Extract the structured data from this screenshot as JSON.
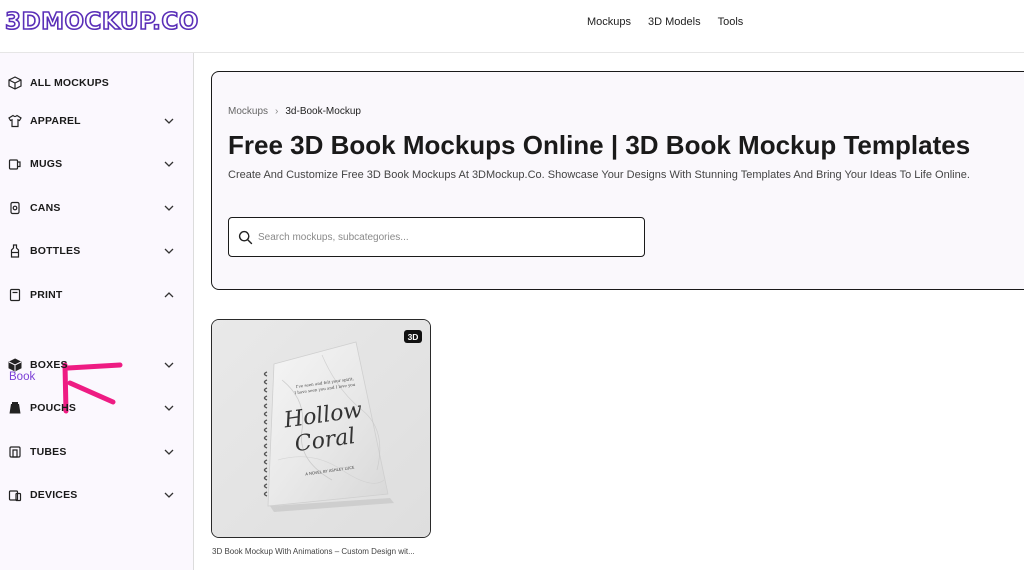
{
  "header": {
    "logo": "3DMOCKUP.CO",
    "nav": [
      "Mockups",
      "3D Models",
      "Tools"
    ]
  },
  "sidebar": {
    "items": [
      {
        "label": "ALL MOCKUPS",
        "icon": "cube-icon"
      },
      {
        "label": "APPAREL",
        "icon": "tshirt-icon",
        "chevron": "down"
      },
      {
        "label": "MUGS",
        "icon": "mug-icon",
        "chevron": "down"
      },
      {
        "label": "CANS",
        "icon": "can-icon",
        "chevron": "down"
      },
      {
        "label": "BOTTLES",
        "icon": "bottle-icon",
        "chevron": "down"
      },
      {
        "label": "PRINT",
        "icon": "print-icon",
        "chevron": "up"
      },
      {
        "label": "BOXES",
        "icon": "box-icon",
        "chevron": "down"
      },
      {
        "label": "POUCHS",
        "icon": "pouch-icon",
        "chevron": "down"
      },
      {
        "label": "TUBES",
        "icon": "tube-icon",
        "chevron": "down"
      },
      {
        "label": "DEVICES",
        "icon": "devices-icon",
        "chevron": "down"
      }
    ],
    "print_sub": "Book"
  },
  "breadcrumb": {
    "root": "Mockups",
    "separator": "›",
    "current": "3d-Book-Mockup"
  },
  "hero": {
    "title": "Free 3D Book Mockups Online | 3D Book Mockup Templates",
    "description": "Create And Customize Free 3D Book Mockups At 3DMockup.Co. Showcase Your Designs With Stunning Templates And Bring Your Ideas To Life Online."
  },
  "search": {
    "placeholder": "Search mockups, subcategories..."
  },
  "card": {
    "badge": "3D",
    "book_tagline": "I've seen and felt your spirit,\nI have seen you and I love you",
    "book_title_1": "Hollow",
    "book_title_2": "Coral",
    "book_author": "A NOVEL BY ASHLEY LUCE",
    "title": "3D Book Mockup With Animations – Custom Design wit..."
  },
  "colors": {
    "accent": "#7b3fd6",
    "logo_stroke": "#5a2fb8",
    "sidebar_bg": "#fbf8fe",
    "annotation": "#ee1c83"
  }
}
